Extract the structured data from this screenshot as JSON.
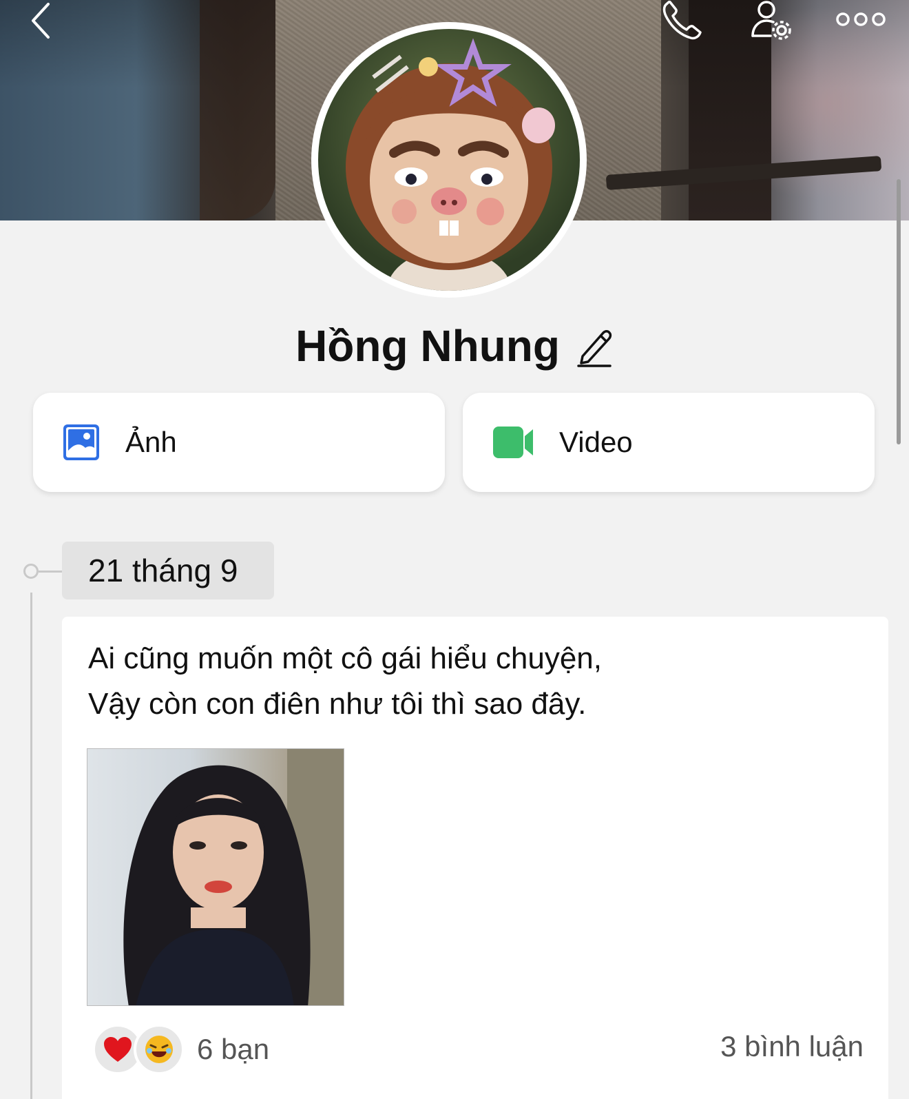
{
  "profile": {
    "name": "Hồng Nhung"
  },
  "media": {
    "photo_label": "Ảnh",
    "video_label": "Video"
  },
  "timeline": {
    "date": "21 tháng 9"
  },
  "post": {
    "line1": "Ai cũng muốn một cô gái hiểu chuyện,",
    "line2": "Vậy còn con điên như tôi thì sao đây.",
    "reaction_count": "6 bạn",
    "comment_count": "3 bình luận"
  },
  "icons": {
    "back": "chevron-left",
    "call": "phone",
    "settings": "user-settings",
    "more": "more-dots",
    "edit": "pencil",
    "photo": "image",
    "video": "video-camera"
  },
  "colors": {
    "photo_icon": "#2f6fe4",
    "video_icon": "#3dbd6b",
    "text": "#111111",
    "muted": "#555555",
    "background": "#f2f2f2"
  }
}
